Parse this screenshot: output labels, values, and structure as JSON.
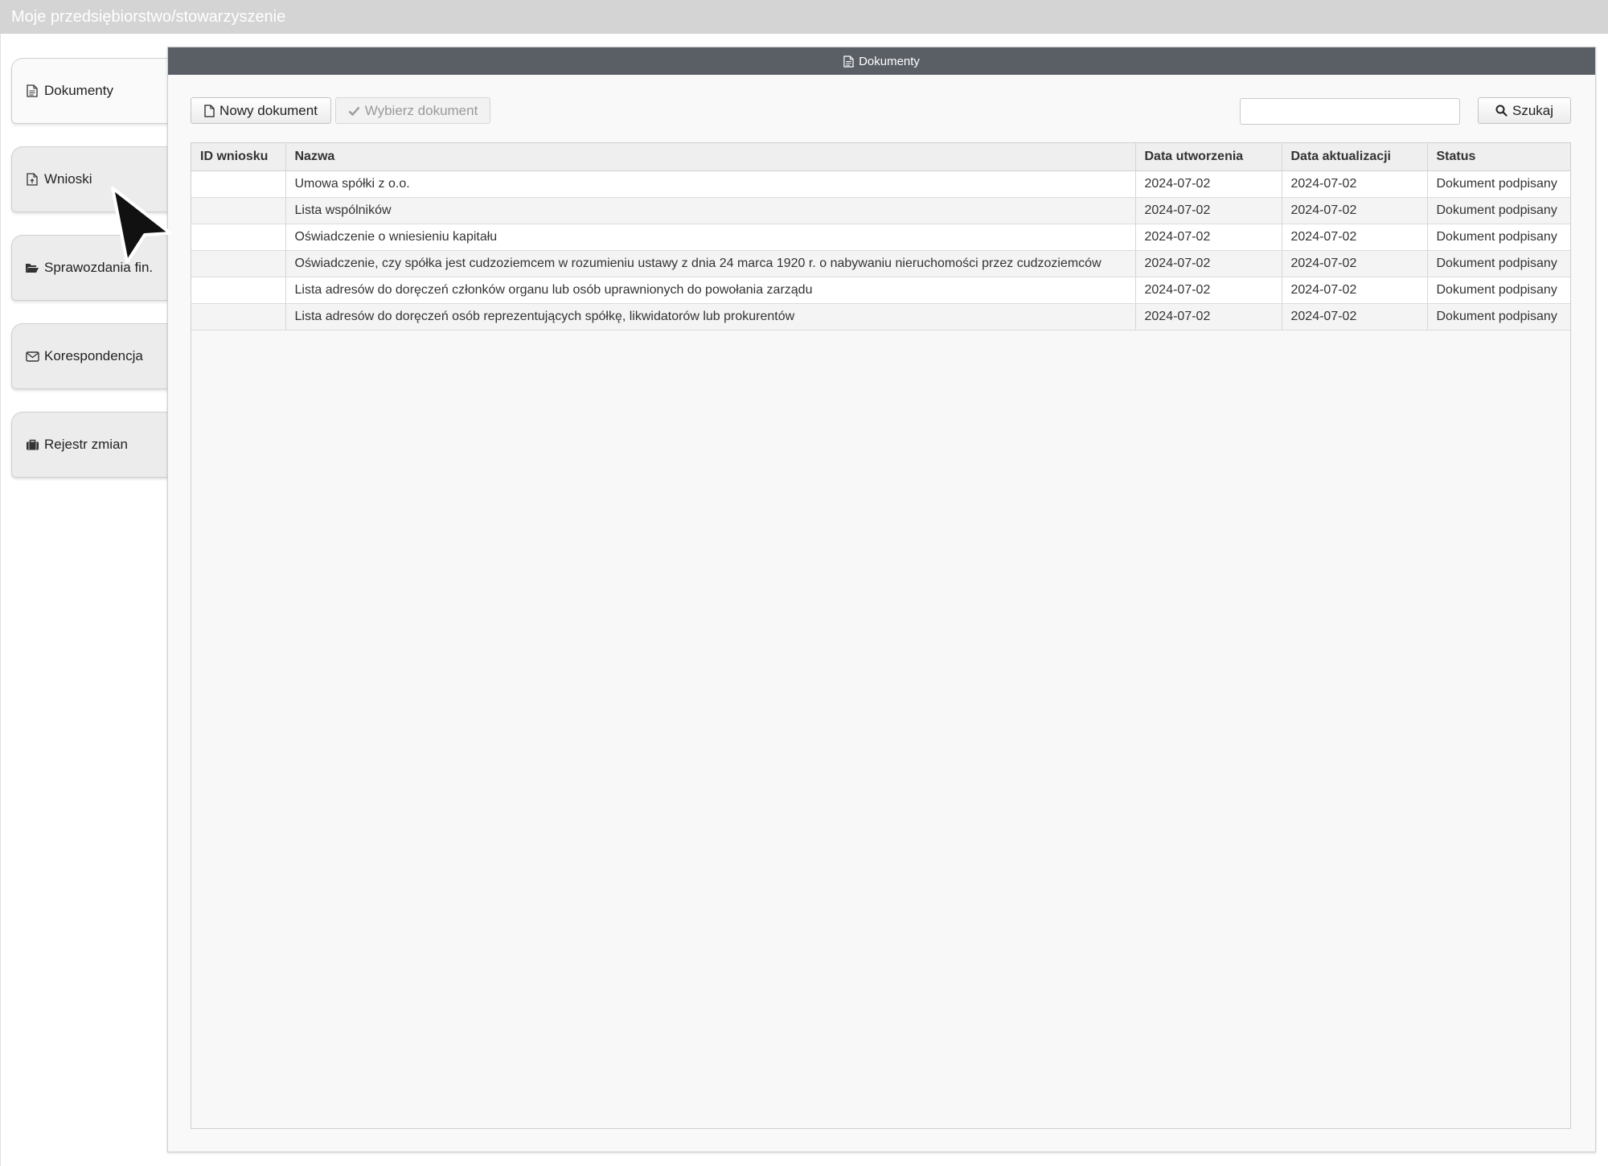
{
  "window": {
    "title": "Moje przedsiębiorstwo/stowarzyszenie"
  },
  "sidebar": {
    "items": [
      {
        "label": "Dokumenty",
        "icon": "document-icon",
        "active": true
      },
      {
        "label": "Wnioski",
        "icon": "document-upload-icon",
        "active": false
      },
      {
        "label": "Sprawozdania fin.",
        "icon": "folder-open-icon",
        "active": false
      },
      {
        "label": "Korespondencja",
        "icon": "envelope-icon",
        "active": false
      },
      {
        "label": "Rejestr zmian",
        "icon": "briefcase-icon",
        "active": false
      }
    ]
  },
  "panel": {
    "title": "Dokumenty",
    "title_icon": "document-icon"
  },
  "toolbar": {
    "new_label": "Nowy dokument",
    "new_icon": "file-icon",
    "choose_label": "Wybierz dokument",
    "choose_icon": "check-icon",
    "search_value": "",
    "search_label": "Szukaj",
    "search_icon": "search-icon"
  },
  "table": {
    "columns": [
      "ID wniosku",
      "Nazwa",
      "Data utworzenia",
      "Data aktualizacji",
      "Status"
    ],
    "rows": [
      {
        "id": "",
        "name": "Umowa spółki z o.o.",
        "created": "2024-07-02",
        "updated": "2024-07-02",
        "status": "Dokument podpisany"
      },
      {
        "id": "",
        "name": "Lista wspólników",
        "created": "2024-07-02",
        "updated": "2024-07-02",
        "status": "Dokument podpisany"
      },
      {
        "id": "",
        "name": "Oświadczenie o wniesieniu kapitału",
        "created": "2024-07-02",
        "updated": "2024-07-02",
        "status": "Dokument podpisany"
      },
      {
        "id": "",
        "name": "Oświadczenie, czy spółka jest cudzoziemcem w rozumieniu ustawy z dnia 24 marca 1920 r. o nabywaniu nieruchomości przez cudzoziemców",
        "created": "2024-07-02",
        "updated": "2024-07-02",
        "status": "Dokument podpisany"
      },
      {
        "id": "",
        "name": "Lista adresów do doręczeń członków organu lub osób uprawnionych do powołania zarządu",
        "created": "2024-07-02",
        "updated": "2024-07-02",
        "status": "Dokument podpisany"
      },
      {
        "id": "",
        "name": "Lista adresów do doręczeń osób reprezentujących spółkę, likwidatorów lub prokurentów",
        "created": "2024-07-02",
        "updated": "2024-07-02",
        "status": "Dokument podpisany"
      }
    ]
  },
  "colors": {
    "titlebar": "#d4d4d4",
    "panel_header": "#5a5f66"
  }
}
